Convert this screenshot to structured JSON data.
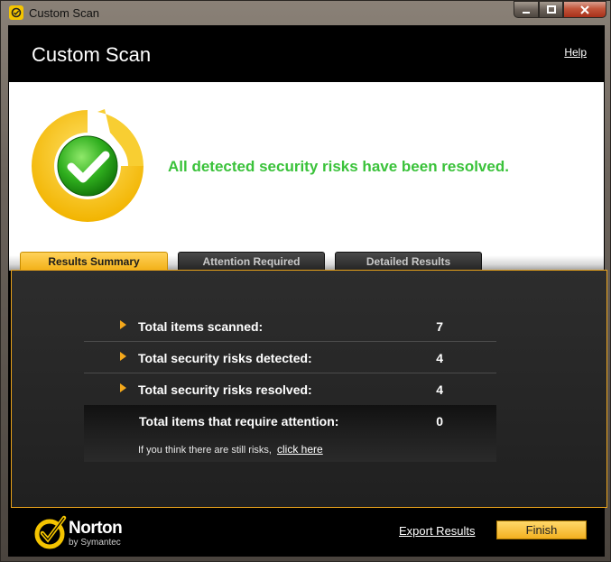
{
  "window": {
    "title": "Custom Scan",
    "controls": {
      "minimize": "▁",
      "maximize": "□",
      "close": "X"
    }
  },
  "header": {
    "title": "Custom Scan",
    "help": "Help"
  },
  "status": {
    "message": "All detected security risks have been resolved.",
    "icon": "checkmark-shield-icon",
    "color": "#3ac23a"
  },
  "tabs": [
    {
      "label": "Results Summary",
      "active": true
    },
    {
      "label": "Attention Required",
      "active": false
    },
    {
      "label": "Detailed Results",
      "active": false
    }
  ],
  "summary": {
    "rows": [
      {
        "label": "Total items scanned:",
        "value": "7"
      },
      {
        "label": "Total security risks detected:",
        "value": "4"
      },
      {
        "label": "Total security risks resolved:",
        "value": "4"
      }
    ],
    "attention": {
      "label": "Total items that require attention:",
      "value": "0",
      "hint": "If you think there are still risks,",
      "hint_link": "click here"
    }
  },
  "footer": {
    "brand": "Norton",
    "brand_sub": "by Symantec",
    "export": "Export Results",
    "finish": "Finish"
  },
  "colors": {
    "accent": "#f3b21a",
    "panel_border": "#e9a21b"
  }
}
